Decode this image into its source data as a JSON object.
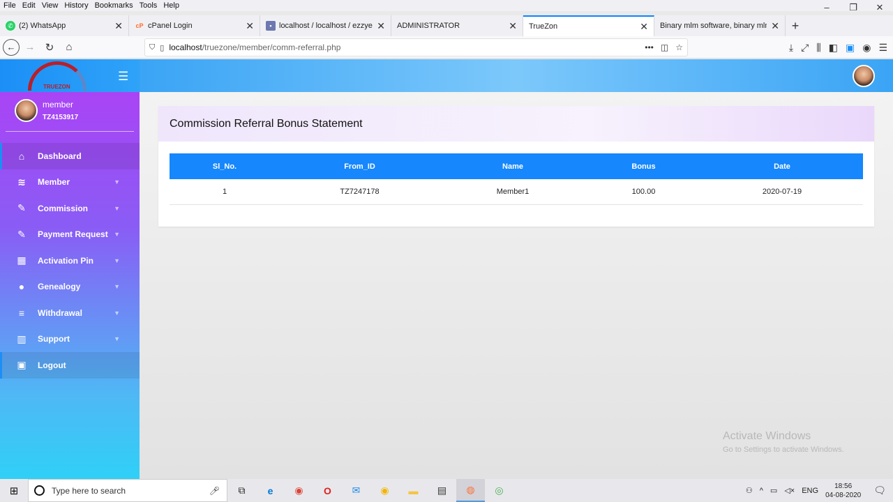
{
  "browser": {
    "menu": [
      "File",
      "Edit",
      "View",
      "History",
      "Bookmarks",
      "Tools",
      "Help"
    ],
    "tabs": [
      {
        "label": "(2) WhatsApp",
        "icon": "whatsapp-icon",
        "color": "#25d366"
      },
      {
        "label": "cPanel Login",
        "icon": "cpanel-icon",
        "color": "#ff6c2c"
      },
      {
        "label": "localhost / localhost / ezzyeam",
        "icon": "phpmyadmin-icon",
        "color": "#6c78af"
      },
      {
        "label": "ADMINISTRATOR",
        "icon": "",
        "color": ""
      },
      {
        "label": "TrueZon",
        "icon": "",
        "color": ""
      },
      {
        "label": "Binary mlm software, binary mlm s",
        "icon": "",
        "color": ""
      }
    ],
    "url_host": "localhost",
    "url_path": "/truezone/member/comm-referral.php"
  },
  "sidebar": {
    "logo_text": "TRUEZON",
    "user": {
      "name": "member",
      "id": "TZ4153917"
    },
    "items": [
      {
        "label": "Dashboard",
        "icon": "home-icon",
        "glyph": "⌂",
        "caret": false
      },
      {
        "label": "Member",
        "icon": "layers-icon",
        "glyph": "≋",
        "caret": true
      },
      {
        "label": "Commission",
        "icon": "edit-icon",
        "glyph": "✎",
        "caret": true
      },
      {
        "label": "Payment Request",
        "icon": "edit-icon",
        "glyph": "✎",
        "caret": true
      },
      {
        "label": "Activation Pin",
        "icon": "grid-icon",
        "glyph": "▦",
        "caret": true
      },
      {
        "label": "Genealogy",
        "icon": "user-icon",
        "glyph": "●",
        "caret": true
      },
      {
        "label": "Withdrawal",
        "icon": "list-icon",
        "glyph": "≡",
        "caret": true
      },
      {
        "label": "Support",
        "icon": "bar-chart-icon",
        "glyph": "▥",
        "caret": true
      },
      {
        "label": "Logout",
        "icon": "lock-icon",
        "glyph": "▣",
        "caret": false
      }
    ]
  },
  "main": {
    "title": "Commission Referral Bonus Statement",
    "columns": [
      "Sl_No.",
      "From_ID",
      "Name",
      "Bonus",
      "Date"
    ],
    "rows": [
      [
        "1",
        "TZ7247178",
        "Member1",
        "100.00",
        "2020-07-19"
      ]
    ]
  },
  "watermark": {
    "line1": "Activate Windows",
    "line2": "Go to Settings to activate Windows."
  },
  "taskbar": {
    "search_placeholder": "Type here to search",
    "lang": "ENG",
    "time": "18:56",
    "date": "04-08-2020"
  },
  "colors": {
    "accent": "#1687fc",
    "sidebar_top": "#b13ef5",
    "sidebar_bottom": "#2fd0f7"
  }
}
